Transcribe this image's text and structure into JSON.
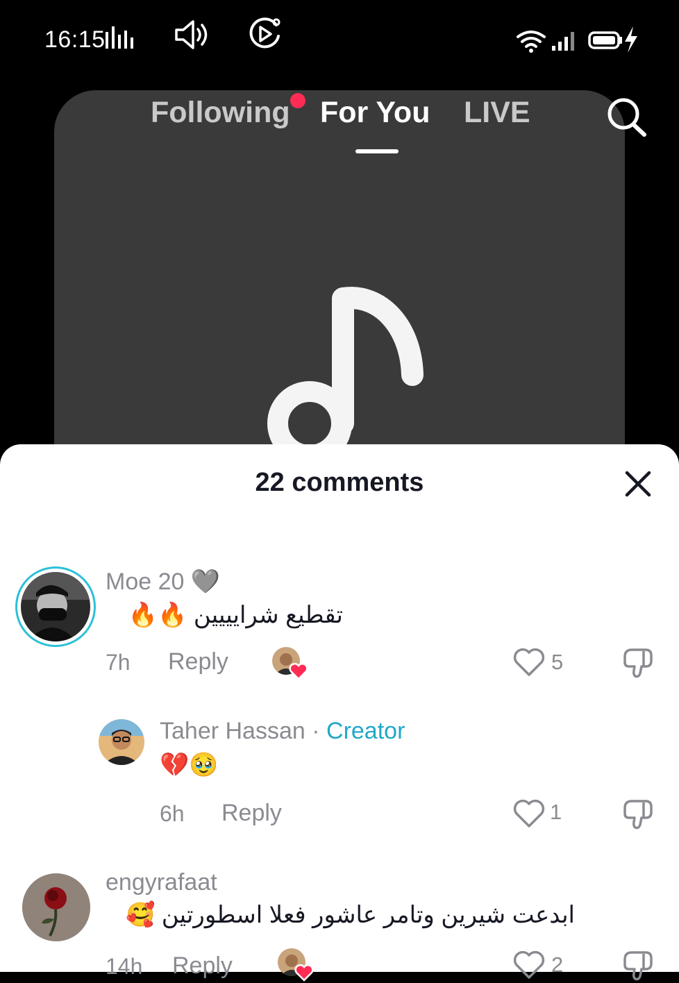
{
  "status_bar": {
    "time": "16:15",
    "icons": [
      "signal-activity-icon",
      "volume-icon",
      "screen-record-icon",
      "wifi-icon",
      "cell-signal-icon",
      "battery-charging-icon"
    ]
  },
  "feed": {
    "tabs": [
      {
        "label": "Following",
        "has_notification_dot": true
      },
      {
        "label": "For You",
        "active": true
      },
      {
        "label": "LIVE"
      }
    ],
    "search_icon": "search-icon",
    "placeholder_icon": "music-note-icon"
  },
  "comments_sheet": {
    "title": "22 comments",
    "close_icon": "close-icon",
    "comments": [
      {
        "username": "Moe 20",
        "username_suffix": "🩶",
        "text": "تقطيع شرايييين 🔥🔥",
        "time": "7h",
        "reply_label": "Reply",
        "liked_by_creator": true,
        "likes": "5"
      },
      {
        "username": "Taher Hassan",
        "separator": "·",
        "badge": "Creator",
        "text": "💔🥹",
        "time": "6h",
        "reply_label": "Reply",
        "likes": "1",
        "is_reply": true
      },
      {
        "username": "engyrafaat",
        "text": "ابدعت شيرين وتامر عاشور فعلا اسطورتين 🥰",
        "time": "14h",
        "reply_label": "Reply",
        "liked_by_creator": true,
        "likes": "2"
      }
    ]
  },
  "colors": {
    "background": "#000000",
    "video_placeholder": "#3a3a3a",
    "notification_dot": "#fe2c55",
    "creator_badge": "#20a8c8",
    "secondary_text": "#8a8b91",
    "primary_text": "#161823"
  }
}
